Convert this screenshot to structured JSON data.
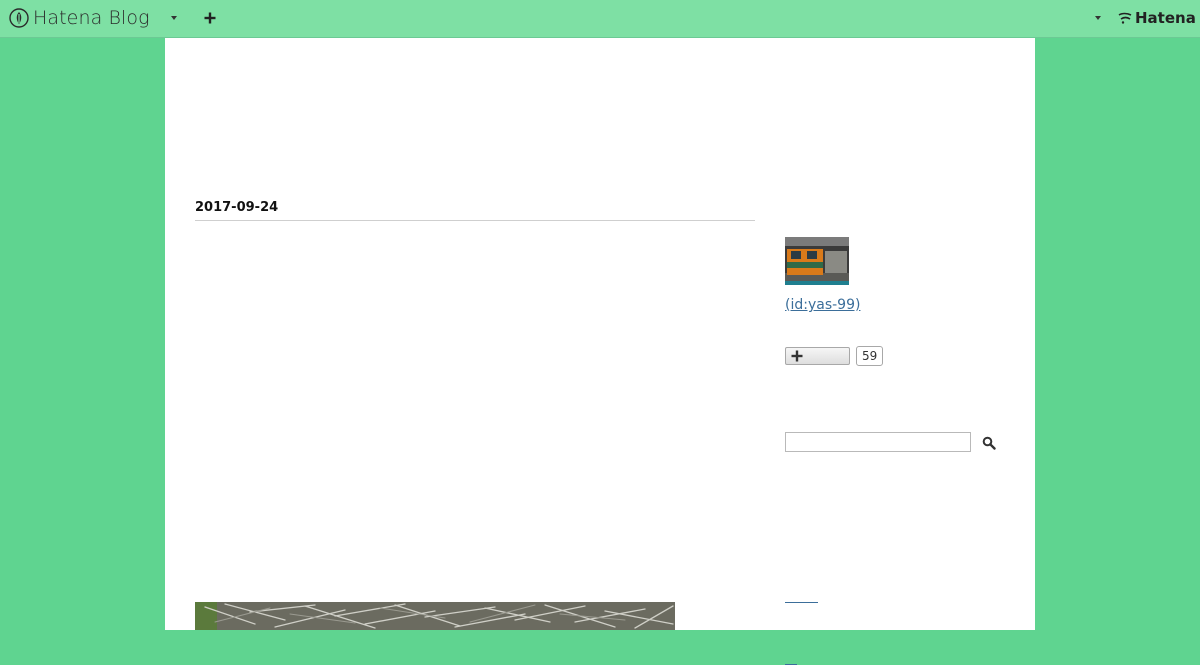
{
  "header": {
    "brand_label": "Hatena Blog",
    "hatena_label": "Hatena",
    "icons": [
      "hatena-blog-logo-icon",
      "chevron-down-icon",
      "plus-icon",
      "chevron-down-icon",
      "hatena-logo-icon"
    ]
  },
  "entry": {
    "date": "2017-09-24"
  },
  "sidebar": {
    "profile_link": " (id:yas-99)",
    "subscribe_count": "59",
    "search_placeholder": ""
  },
  "colors": {
    "background": "#5fd490",
    "header": "#7ee0a4",
    "link": "#3b6e9a",
    "content": "#ffffff"
  }
}
